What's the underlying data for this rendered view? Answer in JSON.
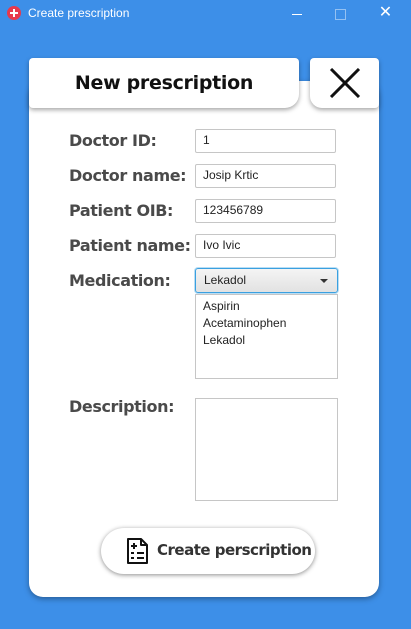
{
  "window": {
    "title": "Create prescription",
    "minimize_glyph": "",
    "close_glyph": "✕"
  },
  "header": {
    "title": "New prescription"
  },
  "form": {
    "doctor_id_label": "Doctor ID:",
    "doctor_id_value": "1",
    "doctor_name_label": "Doctor name:",
    "doctor_name_value": "Josip Krtic",
    "patient_oib_label": "Patient OIB:",
    "patient_oib_value": "123456789",
    "patient_name_label": "Patient name:",
    "patient_name_value": "Ivo Ivic",
    "medication_label": "Medication:",
    "medication_selected": "Lekadol",
    "medication_options": [
      "Aspirin",
      "Acetaminophen",
      "Lekadol"
    ],
    "description_label": "Description:",
    "description_value": ""
  },
  "actions": {
    "create_label": "Create perscription"
  },
  "colors": {
    "background": "#3d8fe8",
    "focus": "#3aa0e0",
    "app_icon": "#e8394d"
  }
}
